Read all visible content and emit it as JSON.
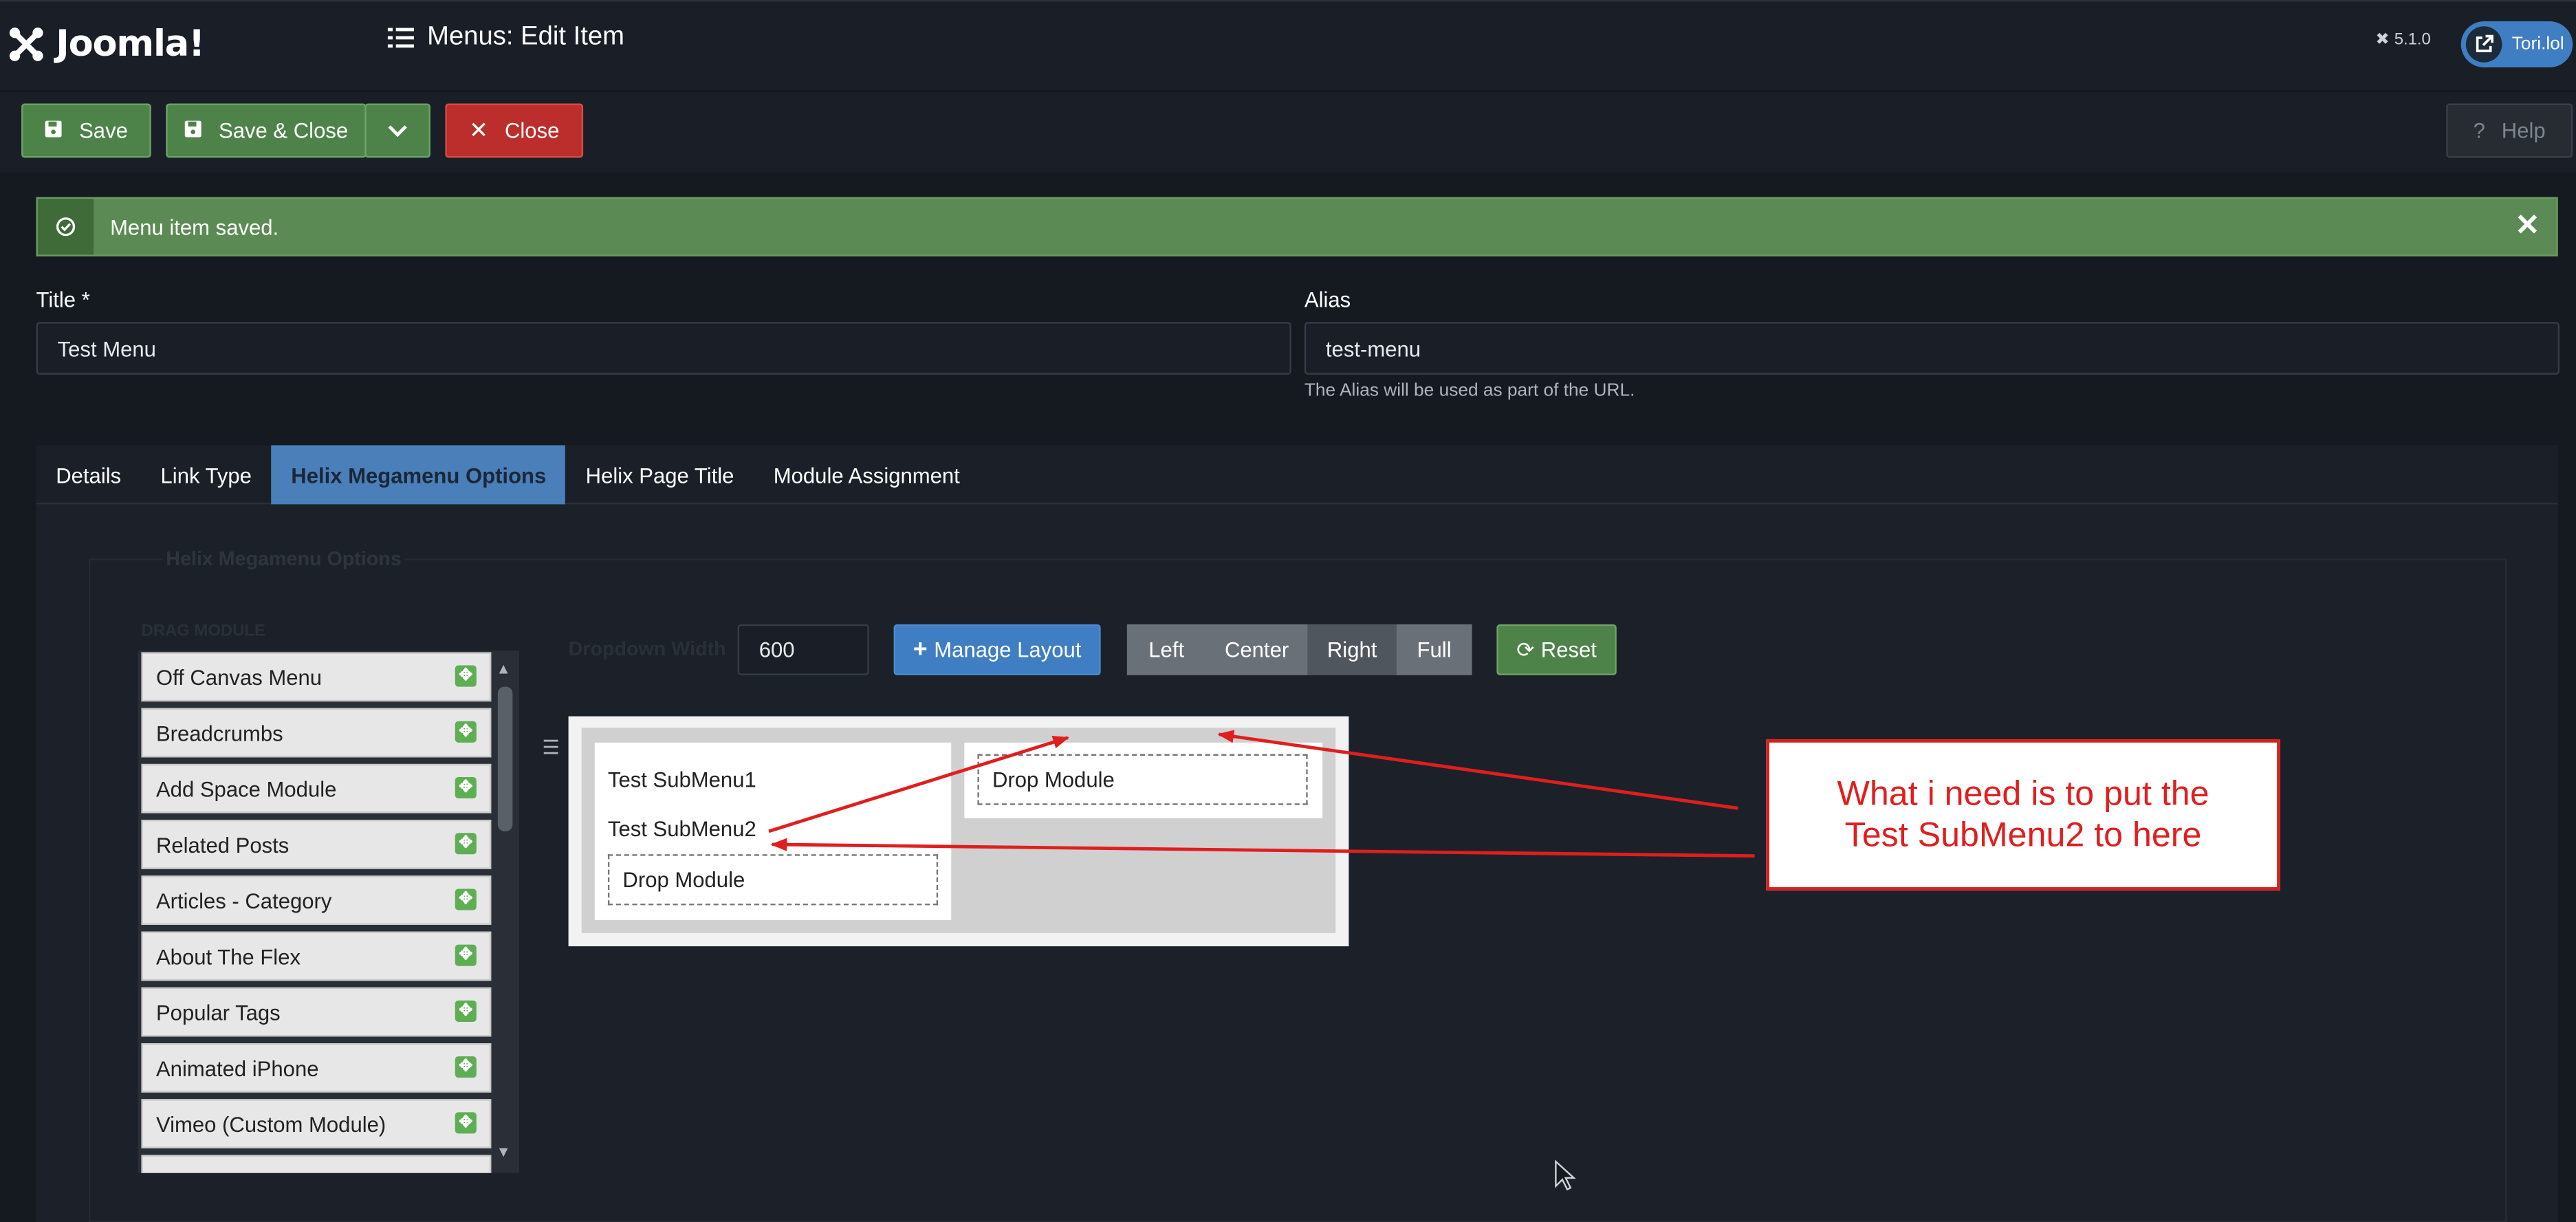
{
  "header": {
    "brand": "Joomla!",
    "page_title": "Menus: Edit Item",
    "version": "5.1.0",
    "user": "Tori.lol"
  },
  "toolbar": {
    "save_label": "Save",
    "save_close_label": "Save & Close",
    "close_label": "Close",
    "help_label": "Help"
  },
  "alert": {
    "message": "Menu item saved."
  },
  "form": {
    "title_label": "Title *",
    "title_value": "Test Menu",
    "alias_label": "Alias",
    "alias_value": "test-menu",
    "alias_help": "The Alias will be used as part of the URL."
  },
  "tabs": [
    {
      "label": "Details"
    },
    {
      "label": "Link Type"
    },
    {
      "label": "Helix Megamenu Options",
      "active": true
    },
    {
      "label": "Helix Page Title"
    },
    {
      "label": "Module Assignment"
    }
  ],
  "megamenu": {
    "legend": "Helix Megamenu Options",
    "drag_label": "DRAG MODULE",
    "modules": [
      "Off Canvas Menu",
      "Breadcrumbs",
      "Add Space Module",
      "Related Posts",
      "Articles - Category",
      "About The Flex",
      "Popular Tags",
      "Animated iPhone",
      "Vimeo (Custom Module)"
    ],
    "dropdown_width_label": "Dropdown Width",
    "dropdown_width_value": "600",
    "manage_layout_label": "Manage Layout",
    "alignment_options": [
      "Left",
      "Center",
      "Right",
      "Full"
    ],
    "alignment_selected": "Right",
    "reset_label": "Reset",
    "column1": {
      "items": [
        "Test SubMenu1",
        "Test SubMenu2"
      ],
      "drop_label": "Drop Module"
    },
    "column2": {
      "drop_label": "Drop Module"
    }
  },
  "annotation": {
    "text_line1": "What i need is to put the",
    "text_line2": "Test SubMenu2 to here",
    "color": "#e01e1e"
  },
  "colors": {
    "background": "#151a21",
    "success": "#5b8a54",
    "primary": "#3f7ec2",
    "danger": "#bb2e2c"
  }
}
